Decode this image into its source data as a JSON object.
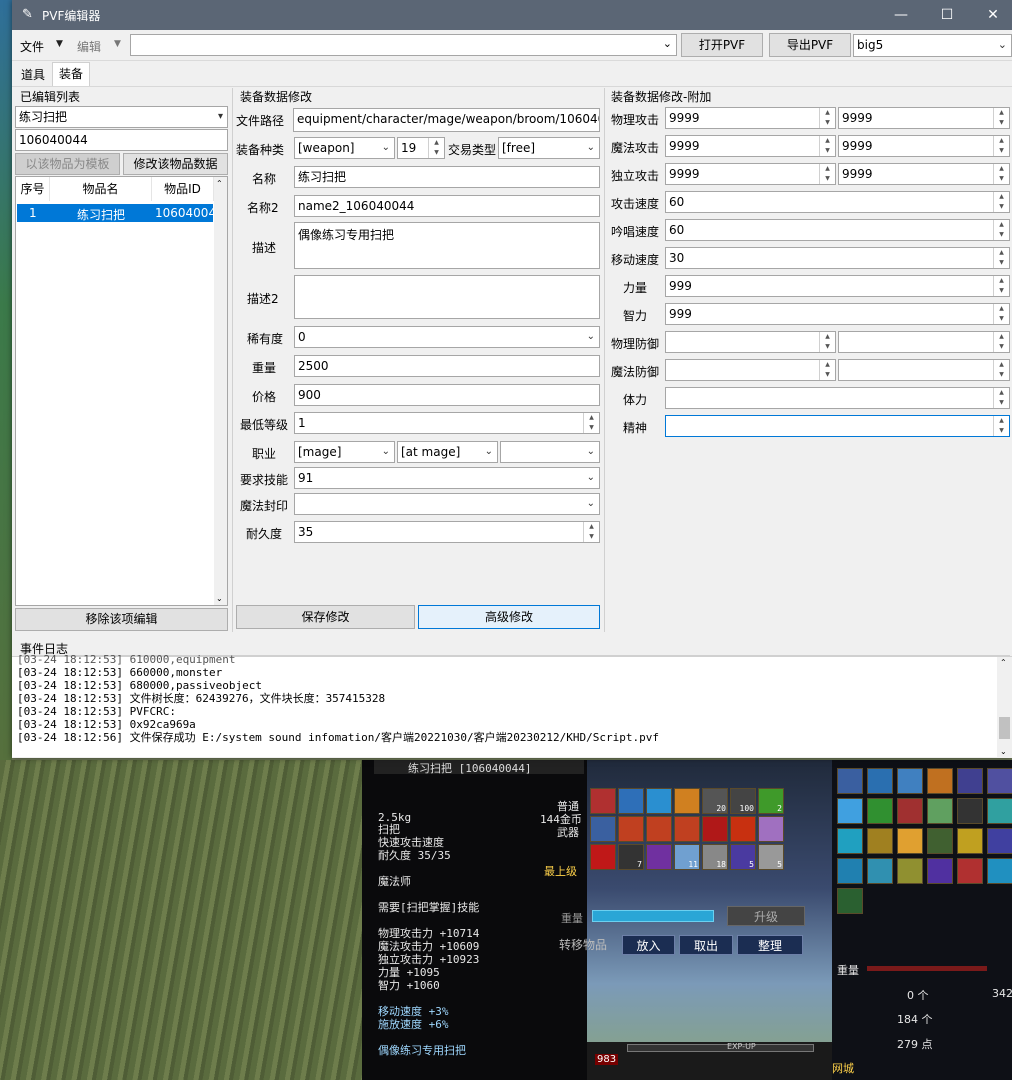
{
  "window": {
    "title": "PVF编辑器",
    "minimize_glyph": "—",
    "maximize_glyph": "☐",
    "close_glyph": "✕"
  },
  "menubar": {
    "file": "文件",
    "edit": "编辑",
    "path_value": "",
    "open_pvf": "打开PVF",
    "export_pvf": "导出PVF",
    "encoding": "big5"
  },
  "tabs": [
    "道具",
    "装备"
  ],
  "edited_list": {
    "title": "已编辑列表",
    "selected_item": "练习扫把",
    "item_code": "106040044",
    "template_button": "以该物品为模板",
    "modify_button": "修改该物品数据",
    "columns": [
      "序号",
      "物品名",
      "物品ID"
    ],
    "rows": [
      {
        "index": "1",
        "name": "练习扫把",
        "id": "10604004"
      }
    ],
    "remove_button": "移除该项编辑"
  },
  "equip_form": {
    "title": "装备数据修改",
    "file_path_label": "文件路径",
    "file_path": "equipment/character/mage/weapon/broom/1060400",
    "type_label": "装备种类",
    "type_value": "[weapon]",
    "type_number": "19",
    "trade_label": "交易类型",
    "trade_value": "[free]",
    "name_label": "名称",
    "name_value": "练习扫把",
    "name2_label": "名称2",
    "name2_value": "name2_106040044",
    "desc_label": "描述",
    "desc_value": "偶像练习专用扫把",
    "desc2_label": "描述2",
    "desc2_value": "",
    "rarity_label": "稀有度",
    "rarity_value": "0",
    "weight_label": "重量",
    "weight_value": "2500",
    "price_label": "价格",
    "price_value": "900",
    "min_level_label": "最低等级",
    "min_level_value": "1",
    "job_label": "职业",
    "job_value": "[mage]",
    "job_sub_value": "[at mage]",
    "job_third_value": "",
    "skill_label": "要求技能",
    "skill_value": "91",
    "seal_label": "魔法封印",
    "seal_value": "",
    "durability_label": "耐久度",
    "durability_value": "35",
    "save_button": "保存修改",
    "advanced_button": "高级修改"
  },
  "extra_form": {
    "title": "装备数据修改-附加",
    "rows": [
      {
        "label": "物理攻击",
        "v1": "9999",
        "v2": "9999"
      },
      {
        "label": "魔法攻击",
        "v1": "9999",
        "v2": "9999"
      },
      {
        "label": "独立攻击",
        "v1": "9999",
        "v2": "9999"
      },
      {
        "label": "攻击速度",
        "v1": "60"
      },
      {
        "label": "吟唱速度",
        "v1": "60"
      },
      {
        "label": "移动速度",
        "v1": "30"
      },
      {
        "label": "力量",
        "v1": "999"
      },
      {
        "label": "智力",
        "v1": "999"
      },
      {
        "label": "物理防御",
        "v1": "",
        "v2": ""
      },
      {
        "label": "魔法防御",
        "v1": "",
        "v2": ""
      },
      {
        "label": "体力",
        "v1": ""
      },
      {
        "label": "精神",
        "v1": ""
      }
    ]
  },
  "event_log": {
    "title": "事件日志",
    "lines": [
      "[03-24 18:12:53]  610000,equipment",
      "[03-24 18:12:53]  660000,monster",
      "[03-24 18:12:53]  680000,passiveobject",
      "[03-24 18:12:53] 文件树长度：62439276，文件块长度：357415328",
      "[03-24 18:12:53] PVFCRC:",
      "[03-24 18:12:53] 0x92ca969a",
      "[03-24 18:12:56] 文件保存成功 E:/system sound infomation/客户端20221030/客户端20230212/KHD/Script.pvf"
    ]
  },
  "game": {
    "tooltip": {
      "header": "练习扫把 [106040044]",
      "weight": "2.5kg",
      "rarity": "普通",
      "price": "144金币",
      "category": "武器",
      "weapon_type": "扫把",
      "attack_speed_label": "快速攻击速度",
      "durability": "耐久度 35/35",
      "level": "最上级",
      "job": "魔法师",
      "skill_req": "需要[扫把掌握]技能",
      "stats": [
        "物理攻击力 +10714",
        "魔法攻击力 +10609",
        "独立攻击力 +10923",
        "力量 +1095",
        "智力 +1060"
      ],
      "bonus": [
        "移动速度 +3%",
        "施放速度 +6%"
      ],
      "flavor": "偶像练习专用扫把"
    },
    "slot_counts": [
      "20",
      "100",
      "2",
      "7",
      "11",
      "18",
      "5",
      "5",
      "983"
    ],
    "upgrade_button": "升级",
    "weight_label": "重量",
    "transfer_button": "转移物品",
    "put_button": "放入",
    "take_button": "取出",
    "sort_button": "整理",
    "exp_label": "EXP-UP",
    "gold_text": "0 个",
    "gold_text_2": "342",
    "count_184": "184 个",
    "points": "279 点",
    "bottom_btn": "网城"
  }
}
